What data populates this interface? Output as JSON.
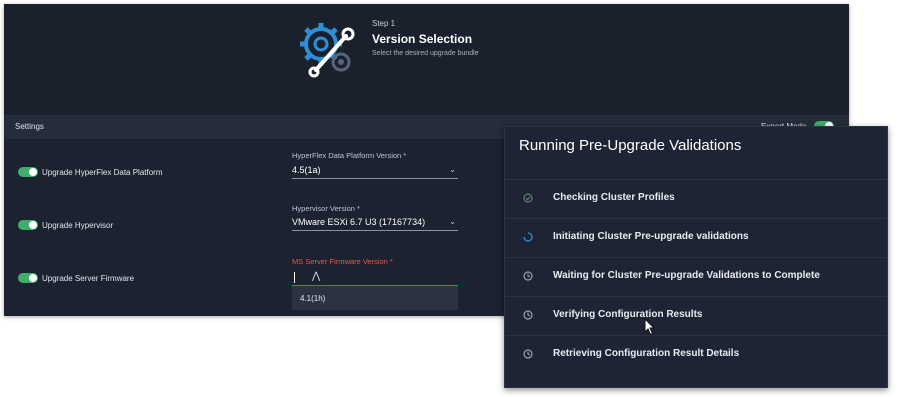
{
  "wizard": {
    "step_label": "Step 1",
    "title": "Version Selection",
    "subtitle": "Select the desired upgrade bundle"
  },
  "settings": {
    "label": "Settings",
    "expert_mode_label": "Expert Mode"
  },
  "options": [
    {
      "label": "Upgrade HyperFlex Data Platform",
      "enabled": true
    },
    {
      "label": "Upgrade Hypervisor",
      "enabled": true
    },
    {
      "label": "Upgrade Server Firmware",
      "enabled": true
    }
  ],
  "fields": {
    "hx_version": {
      "label": "HyperFlex Data Platform Version *",
      "value": "4.5(1a)"
    },
    "hypervisor_version": {
      "label": "Hypervisor Version *",
      "value": "VMware ESXi 6.7 U3 (17167734)"
    },
    "firmware_version": {
      "label": "MS Server Firmware Version *",
      "value": "",
      "dropdown_option": "4.1(1h)"
    }
  },
  "validations": {
    "title": "Running Pre-Upgrade Validations",
    "items": [
      {
        "label": "Checking Cluster Profiles",
        "status": "complete"
      },
      {
        "label": "Initiating Cluster Pre-upgrade validations",
        "status": "in-progress"
      },
      {
        "label": "Waiting for Cluster Pre-upgrade Validations to Complete",
        "status": "pending"
      },
      {
        "label": "Verifying Configuration Results",
        "status": "pending"
      },
      {
        "label": "Retrieving Configuration Result Details",
        "status": "pending"
      }
    ]
  },
  "colors": {
    "toggle_on": "#3fae6a",
    "error": "#d24b43",
    "accent_blue": "#2f8fd6"
  },
  "icons": [
    "gear-wrench-icon",
    "check-circle-icon",
    "spinner-icon",
    "clock-icon",
    "chevron-down-icon",
    "mouse-pointer-icon"
  ]
}
